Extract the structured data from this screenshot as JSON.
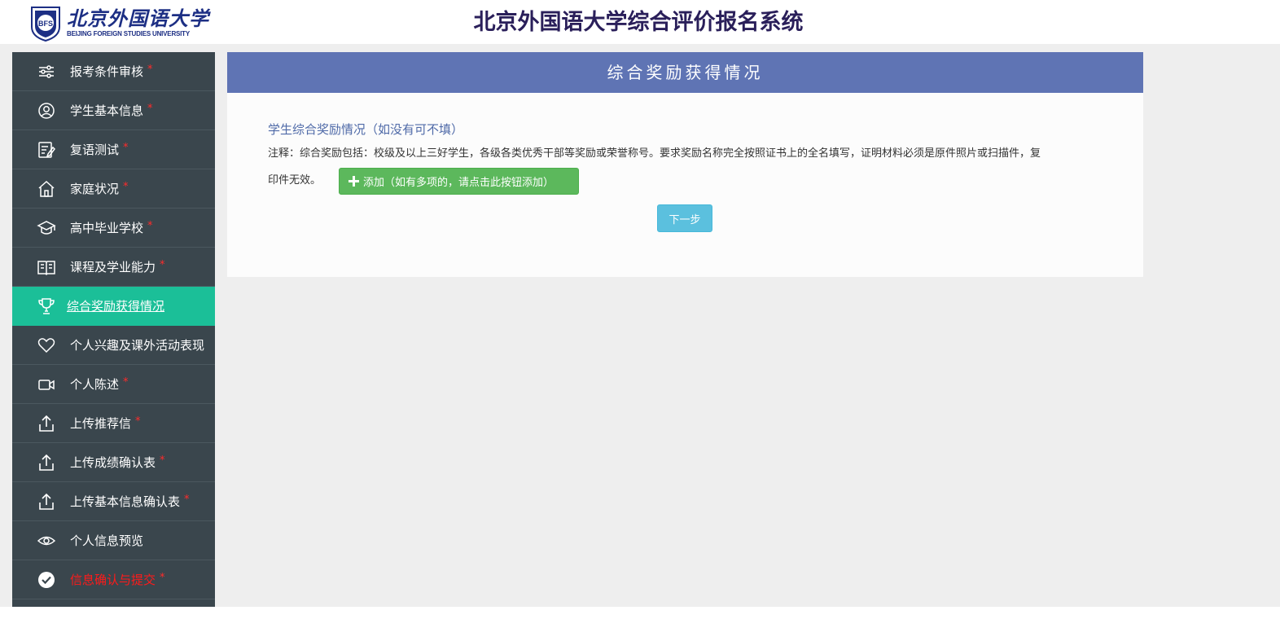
{
  "header": {
    "logo_cn": "北京外国语大学",
    "logo_en": "BEIJING FOREIGN STUDIES UNIVERSITY",
    "seal_text": "BFS",
    "system_title": "北京外国语大学综合评价报名系统"
  },
  "sidebar": {
    "items": [
      {
        "label": "报考条件审核",
        "required": "*",
        "icon": "sliders-icon"
      },
      {
        "label": "学生基本信息",
        "required": "*",
        "icon": "user-circle-icon"
      },
      {
        "label": "复语测试",
        "required": "*",
        "icon": "edit-document-icon"
      },
      {
        "label": "家庭状况",
        "required": "*",
        "icon": "home-icon"
      },
      {
        "label": "高中毕业学校",
        "required": "*",
        "icon": "graduation-cap-icon"
      },
      {
        "label": "课程及学业能力",
        "required": "*",
        "icon": "open-book-icon"
      },
      {
        "label": "综合奖励获得情况",
        "required": "",
        "icon": "trophy-icon",
        "active": true
      },
      {
        "label": "个人兴趣及课外活动表现",
        "required": "",
        "icon": "heart-icon"
      },
      {
        "label": "个人陈述",
        "required": "*",
        "icon": "video-camera-icon"
      },
      {
        "label": "上传推荐信",
        "required": "*",
        "icon": "upload-icon"
      },
      {
        "label": "上传成绩确认表",
        "required": "*",
        "icon": "upload-icon"
      },
      {
        "label": "上传基本信息确认表",
        "required": "*",
        "icon": "upload-icon"
      },
      {
        "label": "个人信息预览",
        "required": "",
        "icon": "eye-icon"
      },
      {
        "label": "信息确认与提交",
        "required": "*",
        "icon": "check-circle-icon",
        "highlight": true
      }
    ]
  },
  "main": {
    "panel_title": "综合奖励获得情况",
    "section_title": "学生综合奖励情况（如没有可不填）",
    "note_line1": "注释：综合奖励包括：校级及以上三好学生，各级各类优秀干部等奖励或荣誉称号。要求奖励名称完全按照证书上的全名填写，证明材料必须是原件照片或扫描件，复",
    "note_line2": "印件无效。",
    "add_button": "添加（如有多项的，请点击此按钮添加）",
    "next_button": "下一步"
  },
  "colors": {
    "sidebar_bg": "#3a464d",
    "active_item": "#1bbf98",
    "panel_header": "#5f74b4",
    "add_button": "#5cb85c",
    "next_button": "#5bc0de",
    "required_mark": "#ff2b2b",
    "title_color": "#2a1f5a"
  }
}
